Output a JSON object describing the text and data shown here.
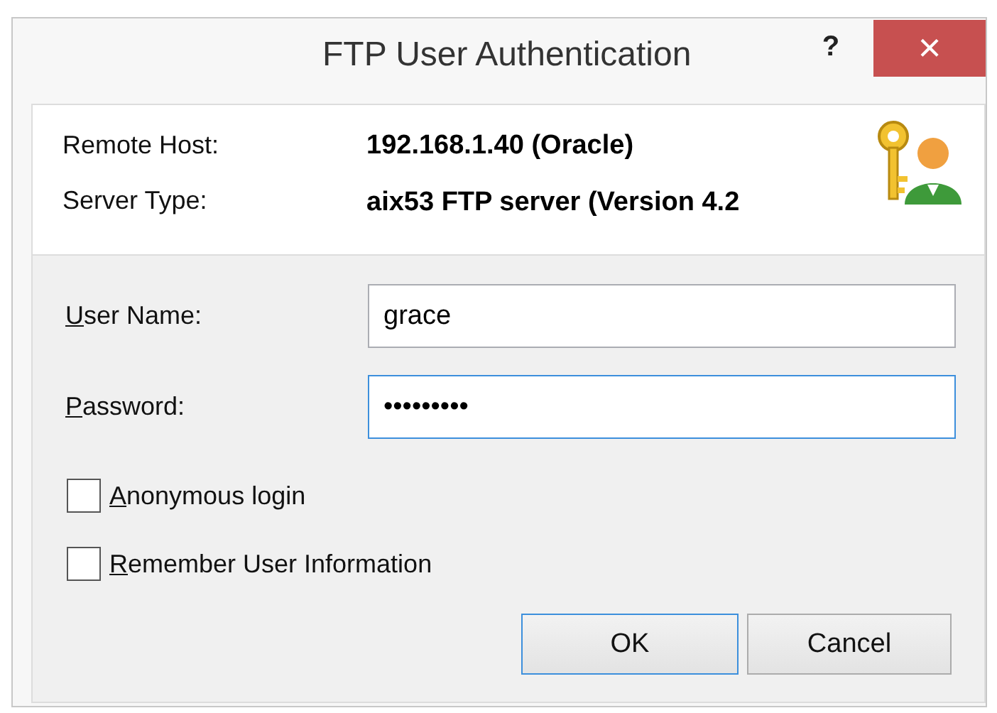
{
  "window": {
    "title": "FTP User Authentication",
    "help": "?",
    "close": "×"
  },
  "info": [
    {
      "label": "Remote Host:",
      "value": "192.168.1.40 (Oracle)"
    },
    {
      "label": "Server Type:",
      "value": "aix53 FTP server (Version 4.2"
    }
  ],
  "fields": [
    {
      "mnemonic": "U",
      "label_rest": "ser Name:",
      "value": "grace",
      "focused": false
    },
    {
      "mnemonic": "P",
      "label_rest": "assword:",
      "value": "•••••••••",
      "focused": true
    }
  ],
  "options": [
    {
      "mnemonic": "A",
      "label_rest": "nonymous login",
      "checked": false
    },
    {
      "mnemonic": "R",
      "label_rest": "emember User Information",
      "checked": false
    }
  ],
  "buttons": [
    {
      "label": "OK",
      "default": true
    },
    {
      "label": "Cancel",
      "default": false
    }
  ]
}
